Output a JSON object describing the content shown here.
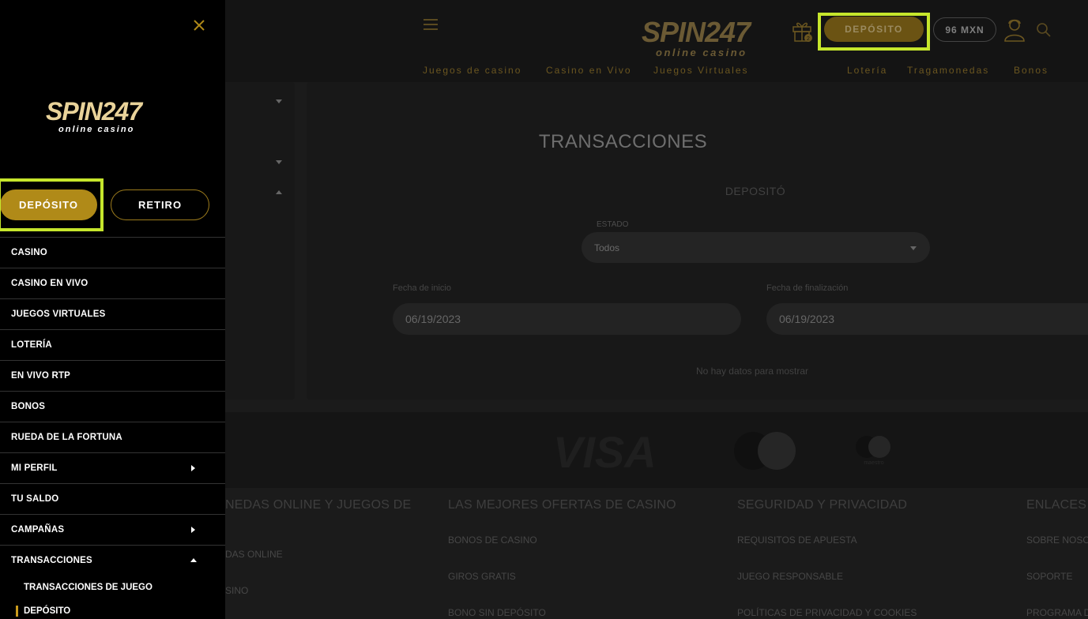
{
  "header": {
    "logo_main": "SPIN247",
    "logo_sub": "online casino",
    "gift_count": "2",
    "deposit_label": "DEPÓSITO",
    "balance": "96 MXN"
  },
  "top_nav": [
    "Juegos de casino",
    "Casino en Vivo",
    "Juegos Virtuales",
    "Lotería",
    "Tragamonedas",
    "Bonos"
  ],
  "transactions": {
    "title": "TRANSACCIONES",
    "subtitle": "DEPOSITÓ",
    "status_label": "ESTADO",
    "status_value": "Todos",
    "start_label": "Fecha de inicio",
    "start_value": "06/19/2023",
    "end_label": "Fecha de finalización",
    "end_value": "06/19/2023",
    "empty": "No hay datos para mostrar"
  },
  "payments": {
    "visa": "VISA",
    "maestro": "maestro"
  },
  "footer": {
    "col1": {
      "head": "NEDAS ONLINE Y JUEGOS DE",
      "links": [
        "DAS ONLINE",
        "SINO"
      ]
    },
    "col2": {
      "head": "LAS MEJORES OFERTAS DE CASINO",
      "links": [
        "BONOS DE CASINO",
        "GIROS GRATIS",
        "BONO SIN DEPÓSITO"
      ]
    },
    "col3": {
      "head": "SEGURIDAD Y PRIVACIDAD",
      "links": [
        "REQUISITOS DE APUESTA",
        "JUEGO RESPONSABLE",
        "POLÍTICAS DE PRIVACIDAD Y COOKIES"
      ]
    },
    "col4": {
      "head": "ENLACES Ú",
      "links": [
        "SOBRE NOSO",
        "SOPORTE",
        "PROGRAMA D"
      ]
    }
  },
  "sidebar": {
    "logo_main": "SPIN247",
    "logo_sub": "online casino",
    "deposit_label": "DEPÓSITO",
    "withdraw_label": "RETIRO",
    "items": [
      "CASINO",
      "CASINO EN VIVO",
      "JUEGOS VIRTUALES",
      "LOTERÍA",
      "EN VIVO RTP",
      "BONOS",
      "RUEDA DE LA FORTUNA",
      "MI PERFIL",
      "TU SALDO",
      "CAMPAÑAS",
      "TRANSACCIONES"
    ],
    "sub_items": [
      "TRANSACCIONES DE JUEGO",
      "DEPÓSITO"
    ]
  },
  "colors": {
    "accent_gold": "#b08a18",
    "highlight": "#c6e62c",
    "sidebar_bg": "#000000"
  }
}
